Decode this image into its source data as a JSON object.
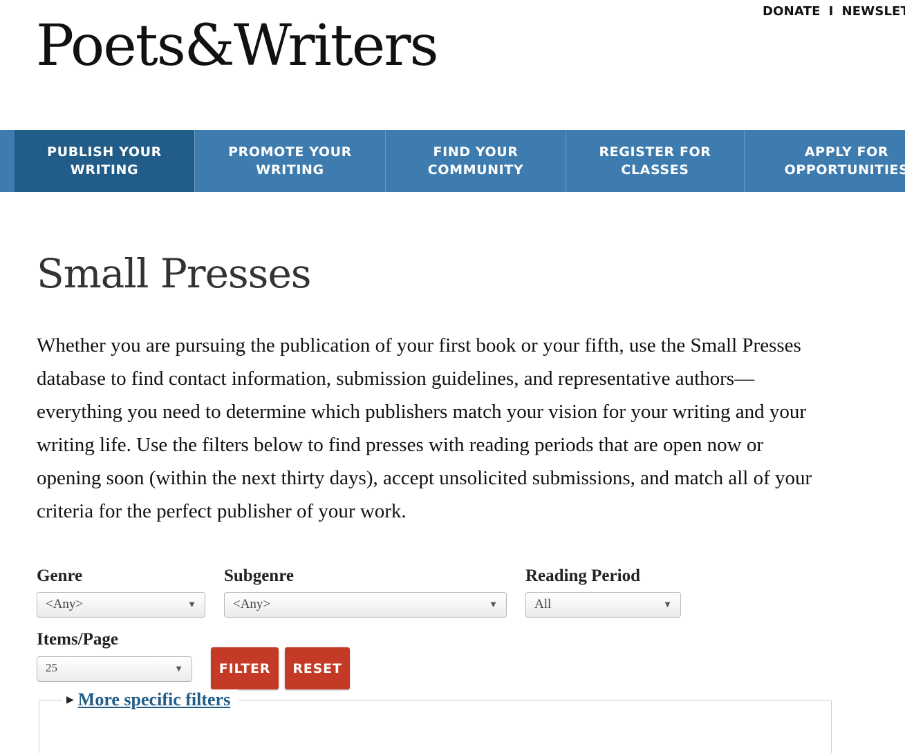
{
  "utility_nav": {
    "donate": "DONATE",
    "separator": "I",
    "newsletter": "NEWSLET"
  },
  "logo": {
    "text": "Poets&Writers"
  },
  "main_nav": [
    {
      "line1": "PUBLISH YOUR",
      "line2": "WRITING",
      "active": true
    },
    {
      "line1": "PROMOTE YOUR",
      "line2": "WRITING"
    },
    {
      "line1": "FIND YOUR",
      "line2": "COMMUNITY"
    },
    {
      "line1": "REGISTER FOR",
      "line2": "CLASSES"
    },
    {
      "line1": "APPLY FOR",
      "line2": "OPPORTUNITIES"
    }
  ],
  "page": {
    "title": "Small Presses",
    "intro": "Whether you are pursuing the publication of your first book or your fifth, use the Small Presses database to find contact information, submission guidelines, and representative authors—everything you need to determine which publishers match your vision for your writing and your writing life. Use the filters below to find presses with reading periods that are open now or opening soon (within the next thirty days), accept unsolicited submissions, and match all of your criteria for the perfect publisher of your work."
  },
  "filters": {
    "genre": {
      "label": "Genre",
      "value": "<Any>"
    },
    "subgenre": {
      "label": "Subgenre",
      "value": "<Any>"
    },
    "reading_period": {
      "label": "Reading Period",
      "value": "All"
    },
    "items_per_page": {
      "label": "Items/Page",
      "value": "25"
    },
    "filter_button": "FILTER",
    "reset_button": "RESET",
    "more_filters": "More specific filters"
  },
  "icons": {
    "dropdown": "chevron-down-icon",
    "disclosure": "triangle-right-icon"
  },
  "colors": {
    "nav_bg": "#3e7caf",
    "nav_active": "#215d88",
    "button": "#c43a26",
    "link": "#215d88"
  }
}
